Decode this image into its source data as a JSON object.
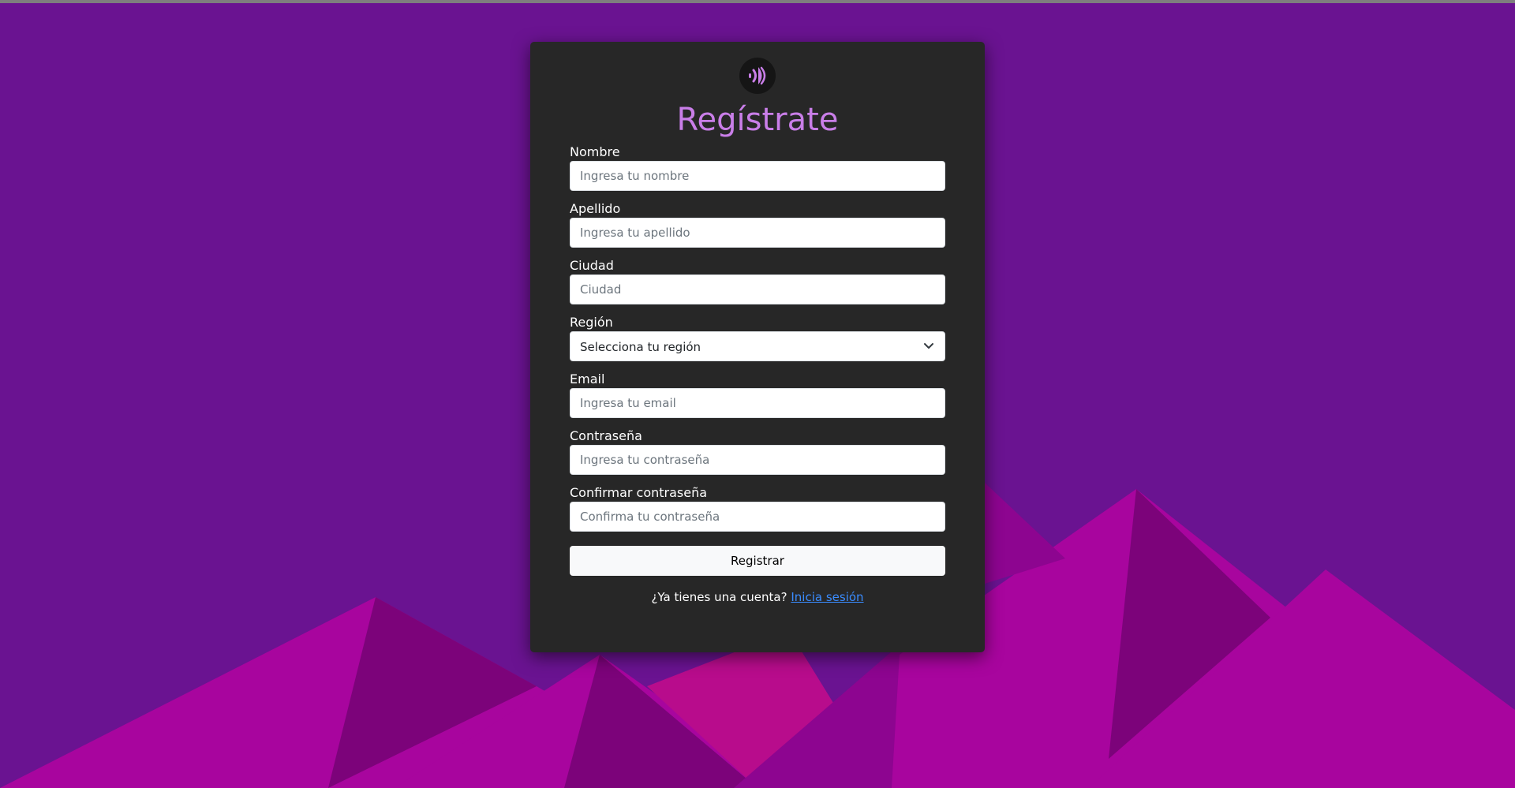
{
  "colors": {
    "background": "#6a1391",
    "card": "#272727",
    "title": "#c97ee8",
    "link": "#3a8cff",
    "mountain_light": "#a8059e",
    "mountain_dark": "#7c037a"
  },
  "logo": {
    "icon": "sound-waves-icon"
  },
  "form": {
    "title": "Regístrate",
    "fields": {
      "nombre": {
        "label": "Nombre",
        "placeholder": "Ingresa tu nombre",
        "value": ""
      },
      "apellido": {
        "label": "Apellido",
        "placeholder": "Ingresa tu apellido",
        "value": ""
      },
      "ciudad": {
        "label": "Ciudad",
        "placeholder": "Ciudad",
        "value": ""
      },
      "region": {
        "label": "Región",
        "selected": "Selecciona tu región"
      },
      "email": {
        "label": "Email",
        "placeholder": "Ingresa tu email",
        "value": ""
      },
      "password": {
        "label": "Contraseña",
        "placeholder": "Ingresa tu contraseña",
        "value": ""
      },
      "confirm_password": {
        "label": "Confirmar contraseña",
        "placeholder": "Confirma tu contraseña",
        "value": ""
      }
    },
    "submit_label": "Registrar",
    "login_prompt": "¿Ya tienes una cuenta?",
    "login_link": "Inicia sesión"
  }
}
